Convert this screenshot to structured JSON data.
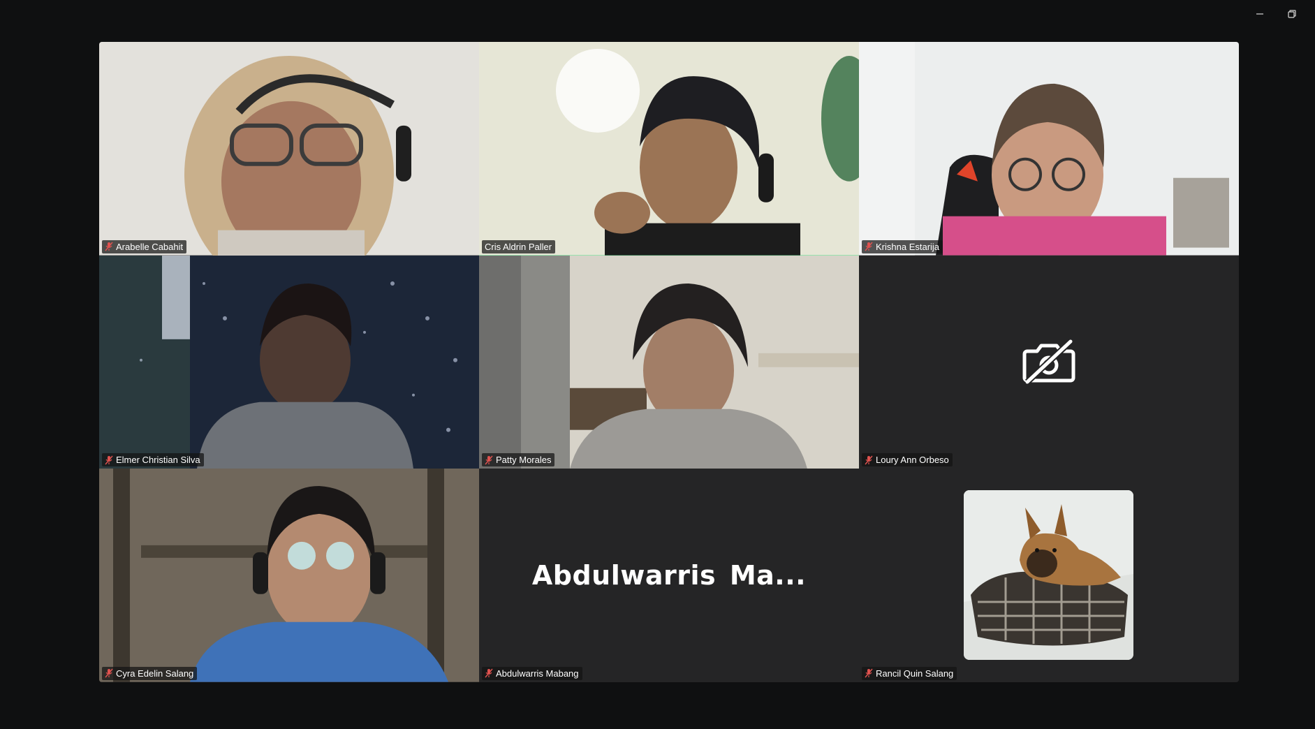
{
  "window": {
    "controls": [
      {
        "icon": "minimize-icon"
      },
      {
        "icon": "restore-icon"
      }
    ]
  },
  "participants": [
    {
      "name": "Arabelle Cabahit",
      "muted": true,
      "video": "on"
    },
    {
      "name": "Cris Aldrin Paller",
      "muted": false,
      "video": "on",
      "active_speaker": true
    },
    {
      "name": "Krishna Estarija",
      "muted": true,
      "video": "on"
    },
    {
      "name": "Elmer Christian Silva",
      "muted": true,
      "video": "on"
    },
    {
      "name": "Patty Morales",
      "muted": true,
      "video": "on"
    },
    {
      "name": "Loury Ann Orbeso",
      "muted": true,
      "video": "off",
      "placeholder_icon": "camera-off-icon"
    },
    {
      "name": "Cyra Edelin Salang",
      "muted": true,
      "video": "on"
    },
    {
      "name": "Abdulwarris Mabang",
      "muted": true,
      "video": "off",
      "display_name": "Abdulwarris  Ma..."
    },
    {
      "name": "Rancil Quin Salang",
      "muted": true,
      "video": "off",
      "profile_picture": "dog-photo"
    }
  ],
  "colors": {
    "active_speaker_border": "#23d96f",
    "tile_background": "#252526",
    "window_background": "#0f1011",
    "muted_icon": "#e0524f"
  }
}
